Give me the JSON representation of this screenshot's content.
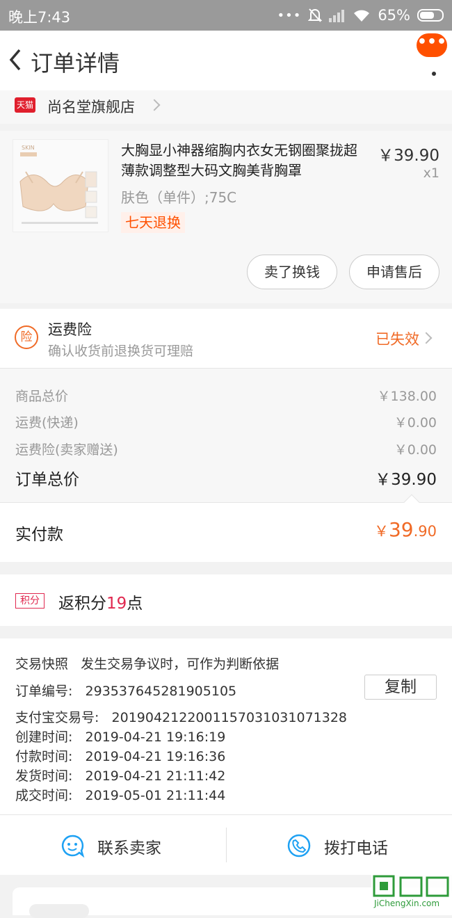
{
  "status_bar": {
    "time": "晚上7:43",
    "battery": "65%"
  },
  "nav": {
    "title": "订单详情"
  },
  "shop": {
    "badge": "天猫",
    "name": "尚名堂旗舰店"
  },
  "product": {
    "title": "大胸显小神器缩胸内衣女无钢圈聚拢超薄款调整型大码文胸美背胸罩",
    "sku": "肤色（单件）;75C",
    "tag": "七天退换",
    "price": "￥39.90",
    "qty": "x1",
    "thumb_label": "SKIN"
  },
  "actions": {
    "sell": "卖了换钱",
    "after_sale": "申请售后"
  },
  "insurance": {
    "icon": "险",
    "title": "运费险",
    "subtitle": "确认收货前退换货可理赔",
    "status": "已失效"
  },
  "pricing": {
    "rows": [
      {
        "label": "商品总价",
        "value": "￥138.00"
      },
      {
        "label": "运费(快递)",
        "value": "￥0.00"
      },
      {
        "label": "运费险(卖家赠送)",
        "value": "￥0.00"
      }
    ],
    "total_label": "订单总价",
    "total_value": "￥39.90"
  },
  "paid": {
    "label": "实付款",
    "symbol": "￥",
    "int": "39",
    "dec": ".90"
  },
  "points": {
    "tag": "积分",
    "prefix": "返积分",
    "number": "19",
    "suffix": "点"
  },
  "order_info": {
    "snapshot_label": "交易快照",
    "snapshot_text": "发生交易争议时，可作为判断依据",
    "order_no_label": "订单编号:",
    "order_no": "293537645281905105",
    "copy_label": "复制",
    "alipay_label": "支付宝交易号:",
    "alipay_no": "2019042122001157031031071328",
    "created_label": "创建时间:",
    "created": "2019-04-21 19:16:19",
    "paid_label": "付款时间:",
    "paid_time": "2019-04-21 19:16:36",
    "shipped_label": "发货时间:",
    "shipped": "2019-04-21 21:11:42",
    "closed_label": "成交时间:",
    "closed": "2019-05-01 21:11:44"
  },
  "contact": {
    "seller": "联系卖家",
    "phone": "拨打电话"
  },
  "watermark": {
    "text": "JiChengXin.com"
  },
  "colors": {
    "accent": "#ff5000",
    "orange": "#f06a26",
    "tmall_red": "#e01f2d",
    "points_red": "#e0284f",
    "blue": "#1ea1f3"
  }
}
